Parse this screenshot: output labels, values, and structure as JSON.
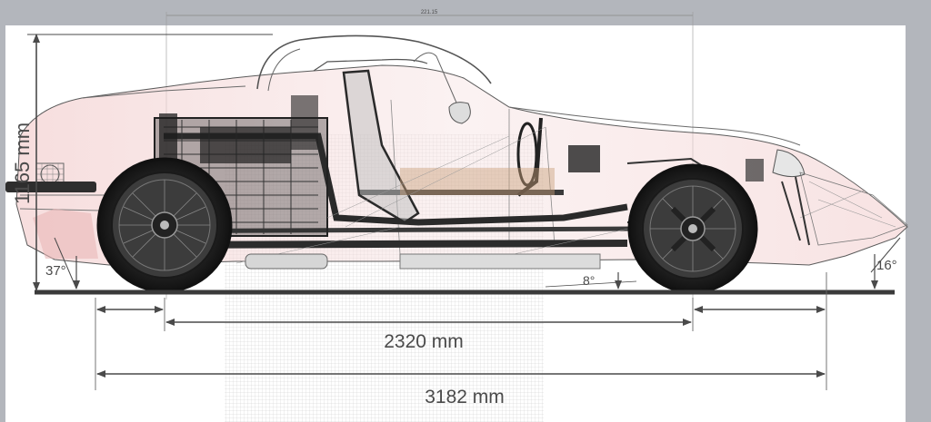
{
  "dimensions": {
    "height_label": "1165 mm",
    "wheelbase_label": "2320 mm",
    "length_label": "3182 mm",
    "top_measure_label": "221.15"
  },
  "angles": {
    "approach_label": "37°",
    "breakover_label": "8°",
    "departure_label": "16°"
  },
  "colors": {
    "background": "#b3b6bc",
    "sheet": "#ffffff",
    "line": "#4a4a4a",
    "ground": "#3a3a3a",
    "body_tint": "#f3cfcf"
  }
}
